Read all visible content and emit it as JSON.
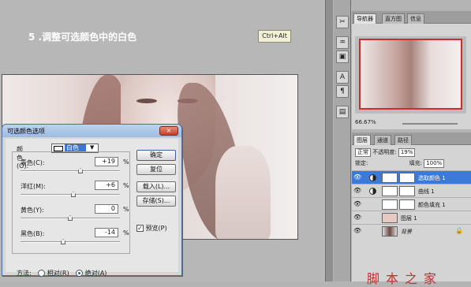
{
  "step": {
    "title": "5 .调整可选颜色中的白色"
  },
  "shortcut": {
    "label": "Ctrl+Alt"
  },
  "dialog": {
    "title": "可选颜色选项",
    "close_label": "×",
    "colors_label": "颜色(O):",
    "colors_value": "白色",
    "sliders": [
      {
        "label": "青色(C):",
        "value": "+19",
        "unit": "%",
        "level": 0.6
      },
      {
        "label": "洋红(M):",
        "value": "+6",
        "unit": "%",
        "level": 0.53
      },
      {
        "label": "黄色(Y):",
        "value": "0",
        "unit": "%",
        "level": 0.5
      },
      {
        "label": "黑色(B):",
        "value": "-14",
        "unit": "%",
        "level": 0.43
      }
    ],
    "buttons": {
      "ok": "确定",
      "reset": "复位",
      "load": "载入(L)...",
      "save": "存储(S)..."
    },
    "preview_label": "预览(P)",
    "preview_checked": true,
    "method_label": "方法:",
    "method_relative": "相对(R)",
    "method_absolute": "绝对(A)",
    "method_selected": "absolute"
  },
  "navigator": {
    "tabs": [
      "导航器",
      "直方图",
      "信息"
    ],
    "zoom": "66.67%"
  },
  "layers": {
    "tabs": [
      "图层",
      "通道",
      "路径"
    ],
    "blend_mode": "正常",
    "opacity_label": "不透明度:",
    "opacity": "19%",
    "lock_label": "锁定:",
    "fill_label": "填充:",
    "fill": "100%",
    "items": [
      {
        "name": "选取颜色 1",
        "selected": true
      },
      {
        "name": "曲线 1",
        "selected": false
      },
      {
        "name": "颜色填充 1",
        "selected": false
      },
      {
        "name": "图层 1",
        "selected": false
      },
      {
        "name": "背景",
        "selected": false
      }
    ]
  },
  "watermark": "脚本之家",
  "colors": {
    "accent": "#3b7ad6",
    "close": "#c0412c",
    "thumb_border": "#c9302c"
  }
}
